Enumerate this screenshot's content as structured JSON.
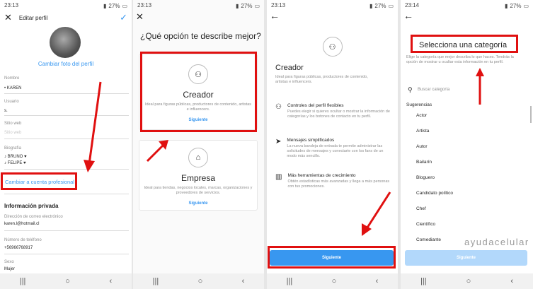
{
  "status_bar": [
    {
      "time": "23:13",
      "battery": "27%"
    },
    {
      "time": "23:13",
      "battery": "27%"
    },
    {
      "time": "23:13",
      "battery": "27%"
    },
    {
      "time": "23:14",
      "battery": "27%"
    }
  ],
  "panel1": {
    "header_title": "Editar perfil",
    "change_photo": "Cambiar foto del perfil",
    "fields": [
      {
        "label": "Nombre",
        "value": "• KAREN"
      },
      {
        "label": "Usuario",
        "value": "s."
      },
      {
        "label": "Sitio web",
        "value": "",
        "placeholder": "Sitio web"
      },
      {
        "label": "Biografía",
        "value_lines": [
          "♪ BRUNO ♥",
          "♪ FELIPE ♥"
        ]
      }
    ],
    "pro_link": "Cambiar a cuenta profesional",
    "private_title": "Información privada",
    "email_label": "Dirección de correo electrónico",
    "email_value": "karen.l@hotmail.cl",
    "phone_label": "Número de teléfono",
    "phone_value": "+56966768917",
    "sex_label": "Sexo",
    "sex_value": "Mujer"
  },
  "panel2": {
    "question": "¿Qué opción te describe mejor?",
    "creator": {
      "title": "Creador",
      "desc": "Ideal para figuras públicas, productores de contenido, artistas e influencers.",
      "next": "Siguiente"
    },
    "business": {
      "title": "Empresa",
      "desc": "Ideal para tiendas, negocios locales, marcas, organizaciones y proveedores de servicios.",
      "next": "Siguiente"
    }
  },
  "panel3": {
    "title": "Creador",
    "desc": "Ideal para figuras públicas, productores de contenido, artistas e influencers.",
    "features": [
      {
        "icon": "person-icon",
        "title": "Controles del perfil flexibles",
        "desc": "Puedes elegir si quieres ocultar o mostrar la información de categorías y los botones de contacto en tu perfil."
      },
      {
        "icon": "send-icon",
        "title": "Mensajes simplificados",
        "desc": "La nueva bandeja de entrada te permite administrar las solicitudes de mensajes y conectarte con los fans de un modo más sencillo."
      },
      {
        "icon": "bar-chart-icon",
        "title": "Más herramientas de crecimiento",
        "desc": "Obtén estadísticas más avanzadas y llega a más personas con tus promociones."
      }
    ],
    "next_button": "Siguiente"
  },
  "panel4": {
    "title": "Selecciona una categoría",
    "desc": "Elige la categoría que mejor describa lo que haces. Tendrás la opción de mostrar u ocultar esta información en tu perfil.",
    "search_placeholder": "Buscar categoría",
    "suggestions_label": "Sugerencias",
    "categories": [
      "Actor",
      "Artista",
      "Autor",
      "Bailarín",
      "Bloguero",
      "Candidato político",
      "Chef",
      "Científico",
      "Comediante"
    ],
    "next_button": "Siguiente"
  },
  "watermark": "ayudacelular",
  "colors": {
    "accent": "#3897f0",
    "highlight": "#e01010"
  }
}
